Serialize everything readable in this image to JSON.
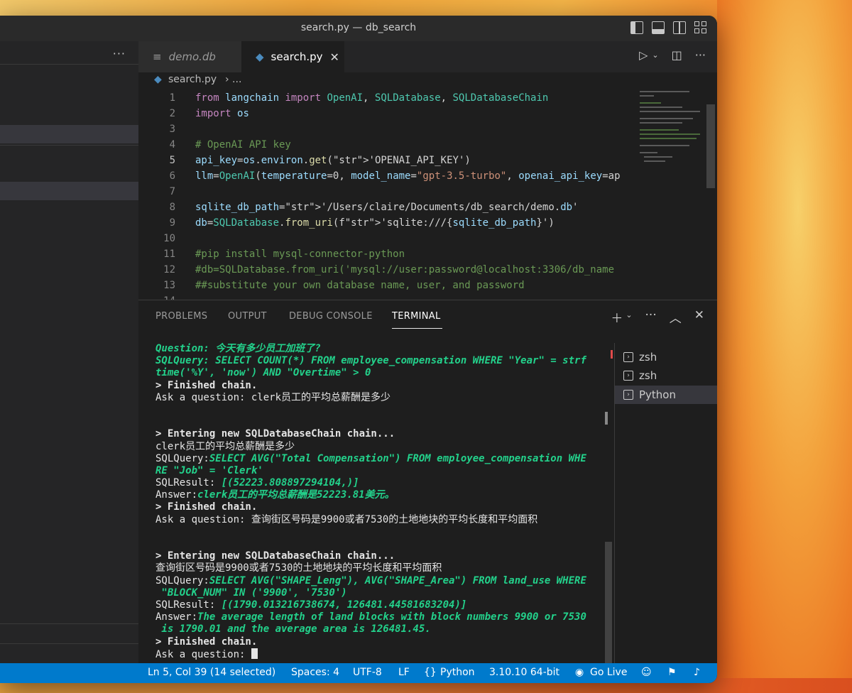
{
  "window": {
    "title": "search.py — db_search"
  },
  "sidebar": {
    "more_label": "···"
  },
  "tabs": [
    {
      "label": "demo.db",
      "icon": "database-icon",
      "active": false
    },
    {
      "label": "search.py",
      "icon": "python-icon",
      "active": true
    }
  ],
  "tab_close_label": "✕",
  "breadcrumb": {
    "file": "search.py",
    "sep": "› ..."
  },
  "editor": {
    "current_line": 5,
    "line_numbers": [
      "1",
      "2",
      "3",
      "4",
      "5",
      "6",
      "7",
      "8",
      "9",
      "10",
      "11",
      "12",
      "13",
      "14"
    ],
    "lines": [
      "from langchain import OpenAI, SQLDatabase, SQLDatabaseChain",
      "import os",
      "",
      "# OpenAI API key",
      "api_key=os.environ.get('OPENAI_API_KEY')",
      "llm=OpenAI(temperature=0, model_name=\"gpt-3.5-turbo\", openai_api_key=ap",
      "",
      "sqlite_db_path='/Users/claire/Documents/db_search/demo.db'",
      "db=SQLDatabase.from_uri(f'sqlite:///{sqlite_db_path}')",
      "",
      "#pip install mysql-connector-python",
      "#db=SQLDatabase.from_uri('mysql://user:password@localhost:3306/db_name",
      "##substitute your own database name, user, and password",
      ""
    ]
  },
  "panel": {
    "tabs": [
      "PROBLEMS",
      "OUTPUT",
      "DEBUG CONSOLE",
      "TERMINAL"
    ],
    "active_tab": "TERMINAL"
  },
  "terminal": {
    "lines": [
      {
        "style": "g",
        "text": "Question: 今天有多少员工加班了?"
      },
      {
        "style": "g",
        "text": "SQLQuery: SELECT COUNT(*) FROM employee_compensation WHERE \"Year\" = strf"
      },
      {
        "style": "g",
        "text": "time('%Y', 'now') AND \"Overtime\" > 0"
      },
      {
        "style": "wb",
        "text": "> Finished chain."
      },
      {
        "style": "w",
        "text": "Ask a question: clerk员工的平均总薪酬是多少"
      },
      {
        "style": "w",
        "text": ""
      },
      {
        "style": "w",
        "text": ""
      },
      {
        "style": "wb",
        "text": "> Entering new SQLDatabaseChain chain..."
      },
      {
        "style": "w",
        "text": "clerk员工的平均总薪酬是多少"
      },
      {
        "style": "mix",
        "prefix": "SQLQuery:",
        "text": "SELECT AVG(\"Total Compensation\") FROM employee_compensation WHE"
      },
      {
        "style": "g",
        "text": "RE \"Job\" = 'Clerk'"
      },
      {
        "style": "mix",
        "prefix": "SQLResult: ",
        "text": "[(52223.808897294104,)]"
      },
      {
        "style": "mix",
        "prefix": "Answer:",
        "text": "clerk员工的平均总薪酬是52223.81美元。"
      },
      {
        "style": "wb",
        "text": "> Finished chain."
      },
      {
        "style": "w",
        "text": "Ask a question: 查询街区号码是9900或者7530的土地地块的平均长度和平均面积"
      },
      {
        "style": "w",
        "text": ""
      },
      {
        "style": "w",
        "text": ""
      },
      {
        "style": "wb",
        "text": "> Entering new SQLDatabaseChain chain..."
      },
      {
        "style": "w",
        "text": "查询街区号码是9900或者7530的土地地块的平均长度和平均面积"
      },
      {
        "style": "mix",
        "prefix": "SQLQuery:",
        "text": "SELECT AVG(\"SHAPE_Leng\"), AVG(\"SHAPE_Area\") FROM land_use WHERE"
      },
      {
        "style": "g",
        "text": " \"BLOCK_NUM\" IN ('9900', '7530')"
      },
      {
        "style": "mix",
        "prefix": "SQLResult: ",
        "text": "[(1790.013216738674, 126481.44581683204)]"
      },
      {
        "style": "mix",
        "prefix": "Answer:",
        "text": "The average length of land blocks with block numbers 9900 or 7530"
      },
      {
        "style": "g",
        "text": " is 1790.01 and the average area is 126481.45."
      },
      {
        "style": "wb",
        "text": "> Finished chain."
      },
      {
        "style": "prompt",
        "text": "Ask a question: "
      }
    ],
    "sessions": [
      {
        "label": "zsh",
        "selected": false
      },
      {
        "label": "zsh",
        "selected": false
      },
      {
        "label": "Python",
        "selected": true
      }
    ]
  },
  "statusbar": {
    "position": "Ln 5, Col 39 (14 selected)",
    "spaces": "Spaces: 4",
    "encoding": "UTF-8",
    "eol": "LF",
    "language": "Python",
    "interpreter": "3.10.10 64-bit",
    "golive": "Go Live"
  },
  "colors": {
    "accent": "#007acc",
    "terminal_green": "#23d18b"
  }
}
